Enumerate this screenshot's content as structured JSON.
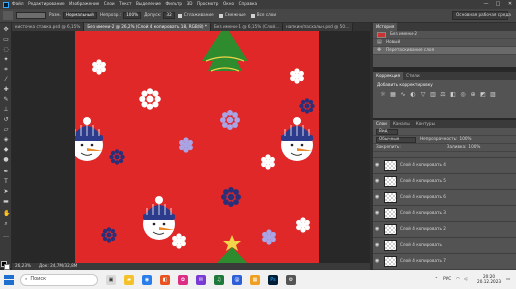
{
  "menu": {
    "items": [
      "Файл",
      "Редактирование",
      "Изображение",
      "Слои",
      "Текст",
      "Выделение",
      "Фильтр",
      "3D",
      "Просмотр",
      "Окно",
      "Справка"
    ]
  },
  "window_controls": [
    "—",
    "□",
    "✕"
  ],
  "options_bar": {
    "mode_label": "Разм.",
    "mode_value": "Нормальный",
    "opacity_label": "Непрозр.:",
    "opacity_value": "100%",
    "flow_label": "Допуск:",
    "flow_value": "32",
    "antialias_label": "Сглаживание",
    "contiguous_label": "Смежные",
    "all_layers_label": "Все слои",
    "workspace": "Основная рабочая среда"
  },
  "tabs": [
    {
      "label": "кисточка ставка.psd @ 6,15%",
      "active": false
    },
    {
      "label": "Без имени-2 @ 26,2% (Слой 4 копировать 18, RGB/8) *",
      "active": true
    },
    {
      "label": "Без имени-1 @ 6,15% (Слой...",
      "active": false
    },
    {
      "label": "напкин/пасхальн.psd @ 50...",
      "active": false
    }
  ],
  "status": {
    "zoom": "26,23%",
    "doc": "Док: 24,7M/32,8M"
  },
  "history": {
    "tabs": [
      "История"
    ],
    "items": [
      {
        "label": "Без имени-2",
        "kind": "snapshot"
      },
      {
        "label": "Новый",
        "kind": "step"
      },
      {
        "label": "Перетаскивание слоя",
        "kind": "step"
      }
    ]
  },
  "adjustments": {
    "tabs": [
      "Коррекция",
      "Стили"
    ],
    "title": "Добавить корректировку"
  },
  "layers": {
    "tabs": [
      "Слои",
      "Каналы",
      "Контуры"
    ],
    "kind_label": "Вид",
    "blend_mode": "Обычные",
    "opacity_label": "Непрозрачность:",
    "opacity_value": "100%",
    "lock_label": "Закрепить:",
    "fill_label": "Заливка:",
    "fill_value": "100%",
    "items": [
      {
        "name": "Слой 4 копировать 4",
        "selected": false
      },
      {
        "name": "Слой 4 копировать 5",
        "selected": false
      },
      {
        "name": "Слой 4 копировать 6",
        "selected": false
      },
      {
        "name": "Слой 4 копировать 3",
        "selected": false
      },
      {
        "name": "Слой 4 копировать 2",
        "selected": false
      },
      {
        "name": "Слой 4 копировать",
        "selected": false
      },
      {
        "name": "Слой 4 копировать 7",
        "selected": false
      },
      {
        "name": "Слой 4 копировать 18",
        "selected": true
      }
    ]
  },
  "taskbar": {
    "search_placeholder": "Поиск",
    "language": "РУС",
    "time": "20:20",
    "date": "20.12.2023"
  },
  "colors": {
    "canvas_background": "#e02828",
    "hat_blue": "#2c3b8c",
    "flake_white": "#ffffff",
    "flake_lavender": "#a9a4e6",
    "flake_navy": "#2a2f7a",
    "tree_green": "#2e8c2e",
    "star_yellow": "#f2d44a",
    "selection_blue": "#7b8ba8"
  }
}
